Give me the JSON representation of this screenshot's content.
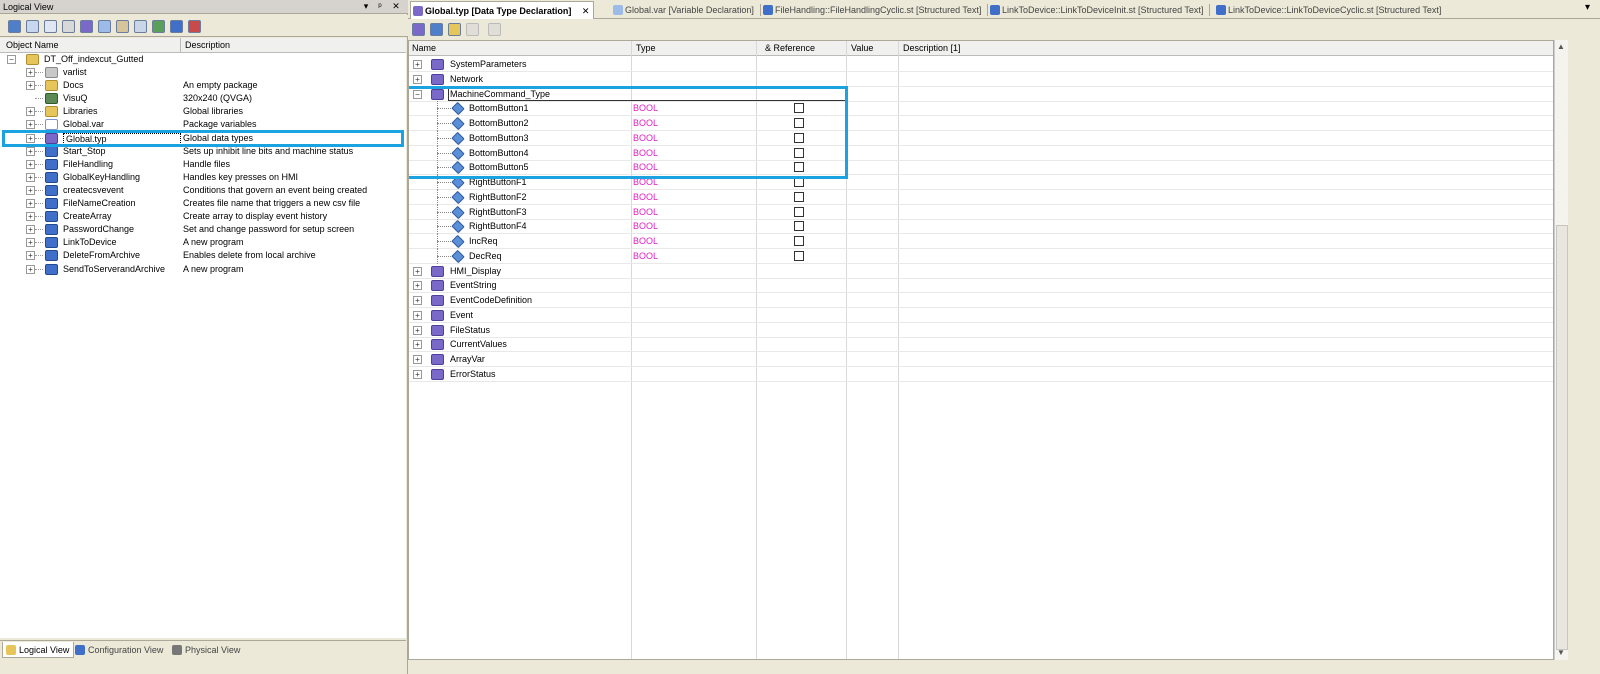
{
  "left_pane": {
    "title": "Logical View",
    "controls": [
      "▾",
      "ᵖ",
      "✕"
    ],
    "headers": {
      "name": "Object Name",
      "description": "Description"
    },
    "root": {
      "name": "DT_Off_indexcut_Gutted"
    },
    "items": [
      {
        "name": "varlist",
        "description": "",
        "icon": "list-icon"
      },
      {
        "name": "Docs",
        "description": "An empty package",
        "icon": "package-icon"
      },
      {
        "name": "VisuQ",
        "description": "320x240 (QVGA)",
        "icon": "visualization-icon"
      },
      {
        "name": "Libraries",
        "description": "Global libraries",
        "icon": "package-icon"
      },
      {
        "name": "Global.var",
        "description": "Package variables",
        "icon": "variable-icon"
      },
      {
        "name": "Global.typ",
        "description": "Global data types",
        "icon": "datatype-icon"
      },
      {
        "name": "Start_Stop",
        "description": "Sets up inhibit line bits and machine status",
        "icon": "program-icon"
      },
      {
        "name": "FileHandling",
        "description": "Handle files",
        "icon": "program-icon"
      },
      {
        "name": "GlobalKeyHandling",
        "description": "Handles key presses on HMI",
        "icon": "program-icon"
      },
      {
        "name": "createcsvevent",
        "description": "Conditions that govern an event being created",
        "icon": "program-icon"
      },
      {
        "name": "FileNameCreation",
        "description": "Creates file name that triggers a new csv file",
        "icon": "program-icon"
      },
      {
        "name": "CreateArray",
        "description": "Create array to display event history",
        "icon": "program-icon"
      },
      {
        "name": "PasswordChange",
        "description": "Set and change password for setup screen",
        "icon": "program-icon"
      },
      {
        "name": "LinkToDevice",
        "description": "A new program",
        "icon": "program-icon"
      },
      {
        "name": "DeleteFromArchive",
        "description": "Enables delete from local archive",
        "icon": "program-icon"
      },
      {
        "name": "SendToServerandArchive",
        "description": "A new program",
        "icon": "program-icon"
      }
    ],
    "bottom_tabs": [
      {
        "label": "Logical View",
        "active": true
      },
      {
        "label": "Configuration View",
        "active": false
      },
      {
        "label": "Physical View",
        "active": false
      }
    ]
  },
  "editor": {
    "tabs": [
      {
        "label": "Global.typ [Data Type Declaration]",
        "active": true
      },
      {
        "label": "Global.var [Variable Declaration]",
        "active": false
      },
      {
        "label": "FileHandling::FileHandlingCyclic.st [Structured Text]",
        "active": false
      },
      {
        "label": "LinkToDevice::LinkToDeviceInit.st [Structured Text]",
        "active": false
      },
      {
        "label": "LinkToDevice::LinkToDeviceCyclic.st [Structured Text]",
        "active": false
      }
    ],
    "close_glyph": "✕",
    "columns": {
      "name": "Name",
      "type": "Type",
      "reference": "& Reference",
      "value": "Value",
      "description": "Description [1]"
    },
    "types_before": [
      "SystemParameters",
      "Network"
    ],
    "expanded_type": "MachineCommand_Type",
    "members": [
      {
        "name": "BottomButton1",
        "type": "BOOL"
      },
      {
        "name": "BottomButton2",
        "type": "BOOL"
      },
      {
        "name": "BottomButton3",
        "type": "BOOL"
      },
      {
        "name": "BottomButton4",
        "type": "BOOL"
      },
      {
        "name": "BottomButton5",
        "type": "BOOL"
      },
      {
        "name": "RightButtonF1",
        "type": "BOOL"
      },
      {
        "name": "RightButtonF2",
        "type": "BOOL"
      },
      {
        "name": "RightButtonF3",
        "type": "BOOL"
      },
      {
        "name": "RightButtonF4",
        "type": "BOOL"
      },
      {
        "name": "IncReq",
        "type": "BOOL"
      },
      {
        "name": "DecReq",
        "type": "BOOL"
      }
    ],
    "types_after": [
      "HMI_Display",
      "EventString",
      "EventCodeDefinition",
      "Event",
      "FileStatus",
      "CurrentValues",
      "ArrayVar",
      "ErrorStatus"
    ]
  },
  "colors": {
    "highlight": "#1aa3e0",
    "type_text": "#e020c0"
  }
}
